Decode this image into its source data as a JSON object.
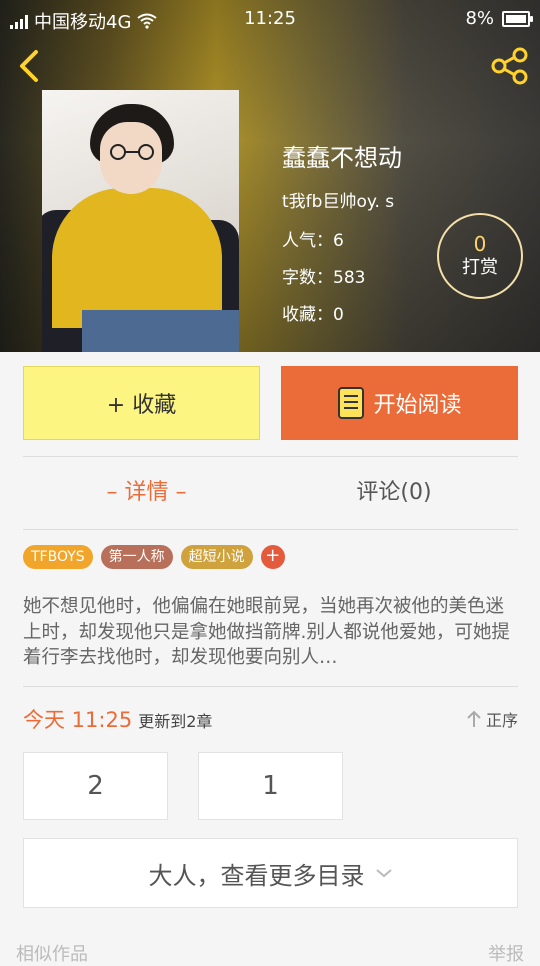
{
  "status_bar": {
    "carrier": "中国移动4G",
    "time": "11:25",
    "battery": "8%"
  },
  "book": {
    "title": "蠢蠢不想动",
    "author": "t我fb巨帅oy. s",
    "popularity": "人气：6",
    "word_count": "字数：583",
    "favorites": "收藏：0"
  },
  "tip": {
    "count": "0",
    "label": "打赏"
  },
  "actions": {
    "favorite": "+ 收藏",
    "start_reading": "开始阅读"
  },
  "tabs": {
    "details": "– 详情 –",
    "comments": "评论(0)"
  },
  "tags": [
    {
      "label": "TFBOYS",
      "color": "#f1a52b"
    },
    {
      "label": "第一人称",
      "color": "#b9705a"
    },
    {
      "label": "超短小说",
      "color": "#cfa23e"
    },
    {
      "label": "+",
      "color": "#e35a3c"
    }
  ],
  "intro": "她不想见他时，他偏偏在她眼前晃，当她再次被他的美色迷上时，却发现他只是拿她做挡箭牌.别人都说他爱她，可她提着行李去找他时，却发现他要向别人…",
  "update": {
    "day": "今天 11:25",
    "text": "更新到2章",
    "sort": "正序"
  },
  "chapters": [
    "2",
    "1"
  ],
  "more_catalog": "大人，查看更多目录",
  "footer": {
    "similar": "相似作品",
    "report": "举报"
  },
  "colors": {
    "accent": "#ec6c39",
    "favorite_bg": "#fdf581"
  }
}
